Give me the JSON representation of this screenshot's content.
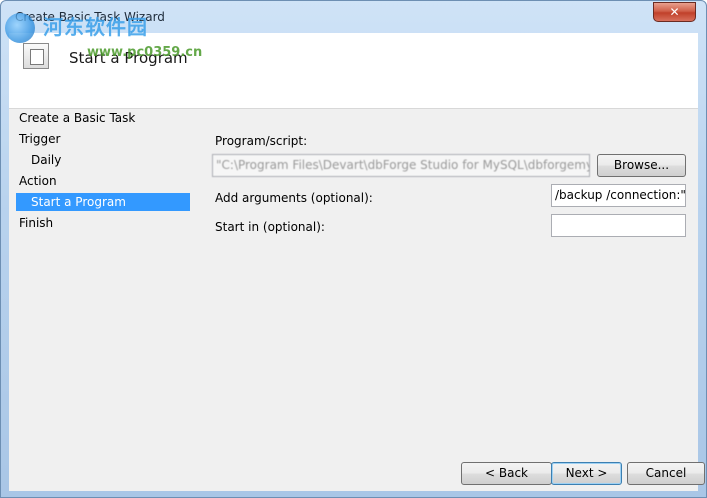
{
  "window": {
    "title": "Create Basic Task Wizard",
    "close_glyph": "✕"
  },
  "watermark": {
    "line1": "河东软件园",
    "line2": "www.pc0359.cn"
  },
  "header": {
    "title": "Start a Program"
  },
  "nav": {
    "items": [
      {
        "label": "Create a Basic Task",
        "selected": false
      },
      {
        "label": "Trigger",
        "selected": false
      },
      {
        "label": "Daily",
        "selected": false
      },
      {
        "label": "Action",
        "selected": false
      },
      {
        "label": "Start a Program",
        "selected": true
      },
      {
        "label": "Finish",
        "selected": false
      }
    ]
  },
  "form": {
    "program_label": "Program/script:",
    "program_value": "\"C:\\Program Files\\Devart\\dbForge Studio for MySQL\\dbforgemysql.co",
    "browse_label": "Browse...",
    "arguments_label": "Add arguments (optional):",
    "arguments_value": "/backup /connection:\"U",
    "start_in_label": "Start in (optional):",
    "start_in_value": ""
  },
  "footer": {
    "back_label": "< Back",
    "next_label": "Next >",
    "cancel_label": "Cancel"
  },
  "colors": {
    "selection": "#3399ff",
    "accent": "#3c7fb1"
  }
}
